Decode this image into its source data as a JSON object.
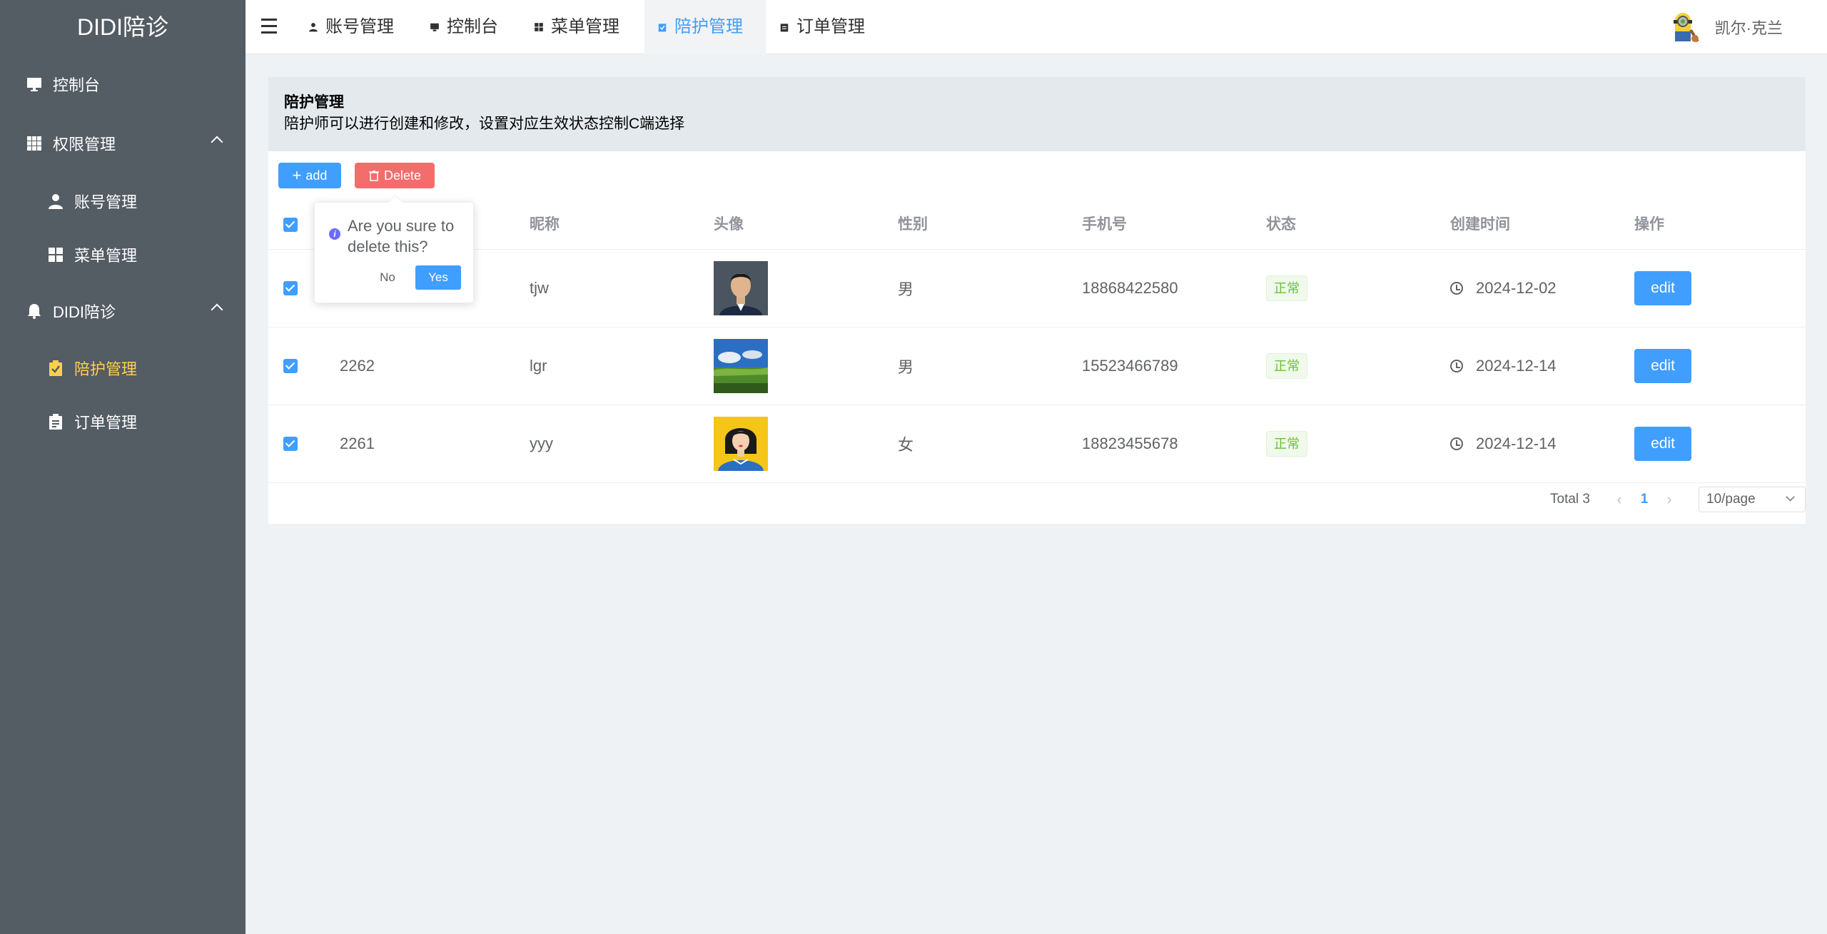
{
  "sidebar": {
    "logo": "DIDI陪诊",
    "items": [
      {
        "label": "控制台",
        "icon": "monitor-icon"
      },
      {
        "label": "权限管理",
        "icon": "grid-icon"
      },
      {
        "label": "账号管理",
        "icon": "user-icon"
      },
      {
        "label": "菜单管理",
        "icon": "menu-grid-icon"
      },
      {
        "label": "DIDI陪诊",
        "icon": "bell-icon"
      },
      {
        "label": "陪护管理",
        "icon": "clipboard-check-icon",
        "active": true
      },
      {
        "label": "订单管理",
        "icon": "document-icon"
      }
    ],
    "background": "#545c64",
    "active_color": "#ffd04b"
  },
  "header": {
    "tabs": [
      {
        "label": "账号管理"
      },
      {
        "label": "控制台"
      },
      {
        "label": "菜单管理"
      },
      {
        "label": "陪护管理",
        "active": true
      },
      {
        "label": "订单管理"
      }
    ],
    "user_name": "凯尔·克兰"
  },
  "panel": {
    "title": "陪护管理",
    "description": "陪护师可以进行创建和修改，设置对应生效状态控制C端选择"
  },
  "toolbar": {
    "add_label": "add",
    "delete_label": "Delete"
  },
  "table": {
    "columns": [
      "昵称",
      "头像",
      "性别",
      "手机号",
      "状态",
      "创建时间",
      "操作"
    ],
    "rows": [
      {
        "id": "",
        "nickname": "tjw",
        "gender": "男",
        "phone": "18868422580",
        "status": "正常",
        "created": "2024-12-02",
        "action": "edit",
        "avatar": "man-portrait"
      },
      {
        "id": "2262",
        "nickname": "lgr",
        "gender": "男",
        "phone": "15523466789",
        "status": "正常",
        "created": "2024-12-14",
        "action": "edit",
        "avatar": "landscape"
      },
      {
        "id": "2261",
        "nickname": "yyy",
        "gender": "女",
        "phone": "18823455678",
        "status": "正常",
        "created": "2024-12-14",
        "action": "edit",
        "avatar": "woman-illustration"
      }
    ]
  },
  "pagination": {
    "total": "Total 3",
    "current_page": "1",
    "page_size": "10/page"
  },
  "popconfirm": {
    "message": "Are you sure to delete this?",
    "no_label": "No",
    "yes_label": "Yes"
  },
  "colors": {
    "primary": "#409eff",
    "danger": "#f56c6c",
    "success": "#67c23a"
  }
}
